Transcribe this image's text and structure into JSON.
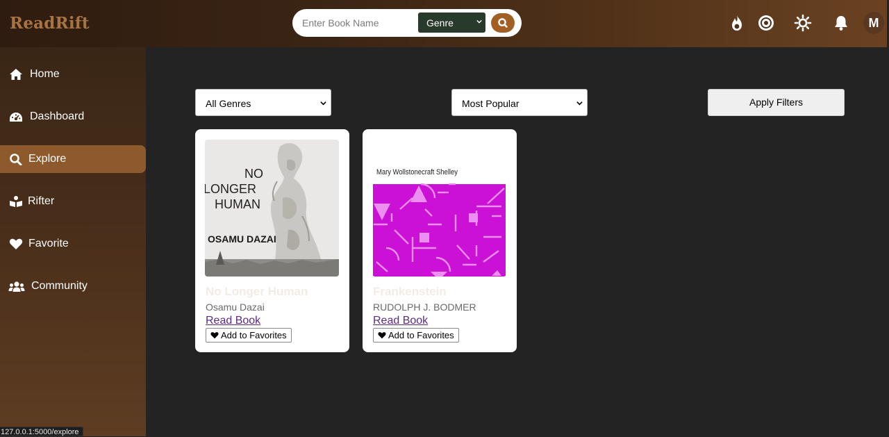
{
  "app": {
    "logo": "ReadRift"
  },
  "header": {
    "search": {
      "placeholder": "Enter Book Name"
    },
    "genre_select": {
      "value": "Genre"
    },
    "avatar_initial": "M"
  },
  "sidebar": {
    "items": [
      {
        "label": "Home",
        "icon": "home-icon"
      },
      {
        "label": "Dashboard",
        "icon": "gauge-icon"
      },
      {
        "label": "Explore",
        "icon": "search-icon",
        "active": true
      },
      {
        "label": "Rifter",
        "icon": "reader-icon"
      },
      {
        "label": "Favorite",
        "icon": "heart-icon"
      },
      {
        "label": "Community",
        "icon": "users-icon"
      }
    ]
  },
  "filters": {
    "genre": "All Genres",
    "sort": "Most Popular",
    "apply_label": "Apply Filters"
  },
  "books": [
    {
      "title": "No Longer Human",
      "author": "Osamu Dazai",
      "read_label": "Read Book",
      "fav_label": "Add to Favorites",
      "cover_text": [
        "NO",
        "LONGER",
        "HUMAN",
        "OSAMU DAZAI"
      ]
    },
    {
      "title": "Frankenstein",
      "author": "RUDOLPH J. BODMER",
      "read_label": "Read Book",
      "fav_label": "Add to Favorites",
      "cover_text": [
        "Mary Wollstonecraft Shelley"
      ]
    }
  ],
  "status_bar": {
    "url": "127.0.0.1:5000/explore"
  },
  "colors": {
    "accent": "#8e5a2c",
    "logo": "#a87444",
    "genre_select_bg": "#283a2b",
    "search_button": "#a25f24",
    "link": "#5b2a86",
    "frankenstein_cover": "#cc11d6"
  }
}
